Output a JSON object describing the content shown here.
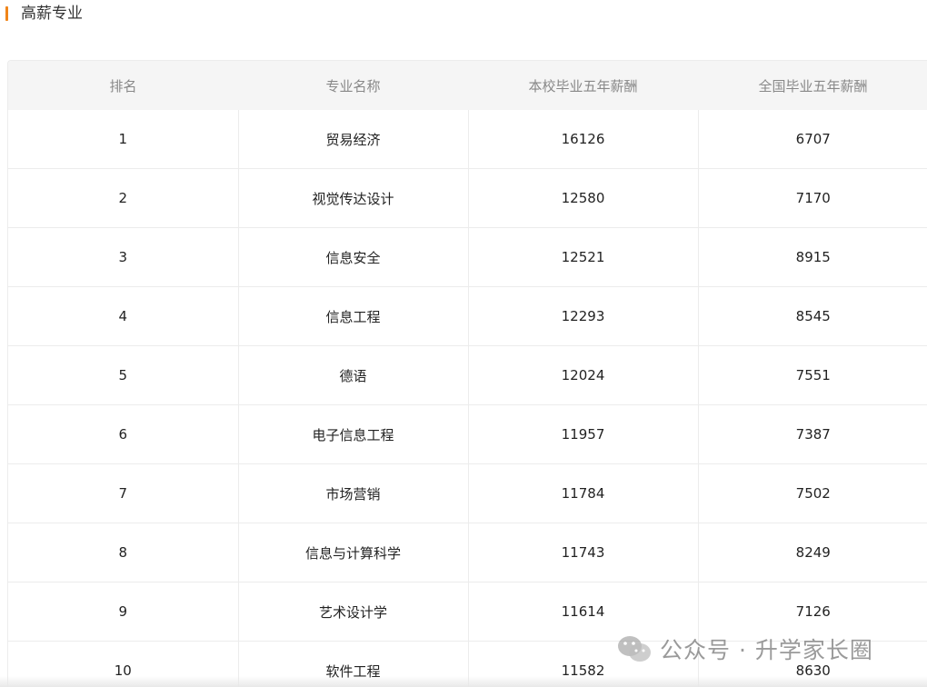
{
  "section": {
    "title": "高薪专业"
  },
  "table": {
    "headers": [
      "排名",
      "专业名称",
      "本校毕业五年薪酬",
      "全国毕业五年薪酬"
    ],
    "rows": [
      [
        "1",
        "贸易经济",
        "16126",
        "6707"
      ],
      [
        "2",
        "视觉传达设计",
        "12580",
        "7170"
      ],
      [
        "3",
        "信息安全",
        "12521",
        "8915"
      ],
      [
        "4",
        "信息工程",
        "12293",
        "8545"
      ],
      [
        "5",
        "德语",
        "12024",
        "7551"
      ],
      [
        "6",
        "电子信息工程",
        "11957",
        "7387"
      ],
      [
        "7",
        "市场营销",
        "11784",
        "7502"
      ],
      [
        "8",
        "信息与计算科学",
        "11743",
        "8249"
      ],
      [
        "9",
        "艺术设计学",
        "11614",
        "7126"
      ],
      [
        "10",
        "软件工程",
        "11582",
        "8630"
      ]
    ]
  },
  "watermark": {
    "text": "公众号 · 升学家长圈",
    "icon": "wechat-icon"
  },
  "colors": {
    "accent": "#f08519",
    "header_bg": "#f5f5f5",
    "border": "#ececec"
  }
}
